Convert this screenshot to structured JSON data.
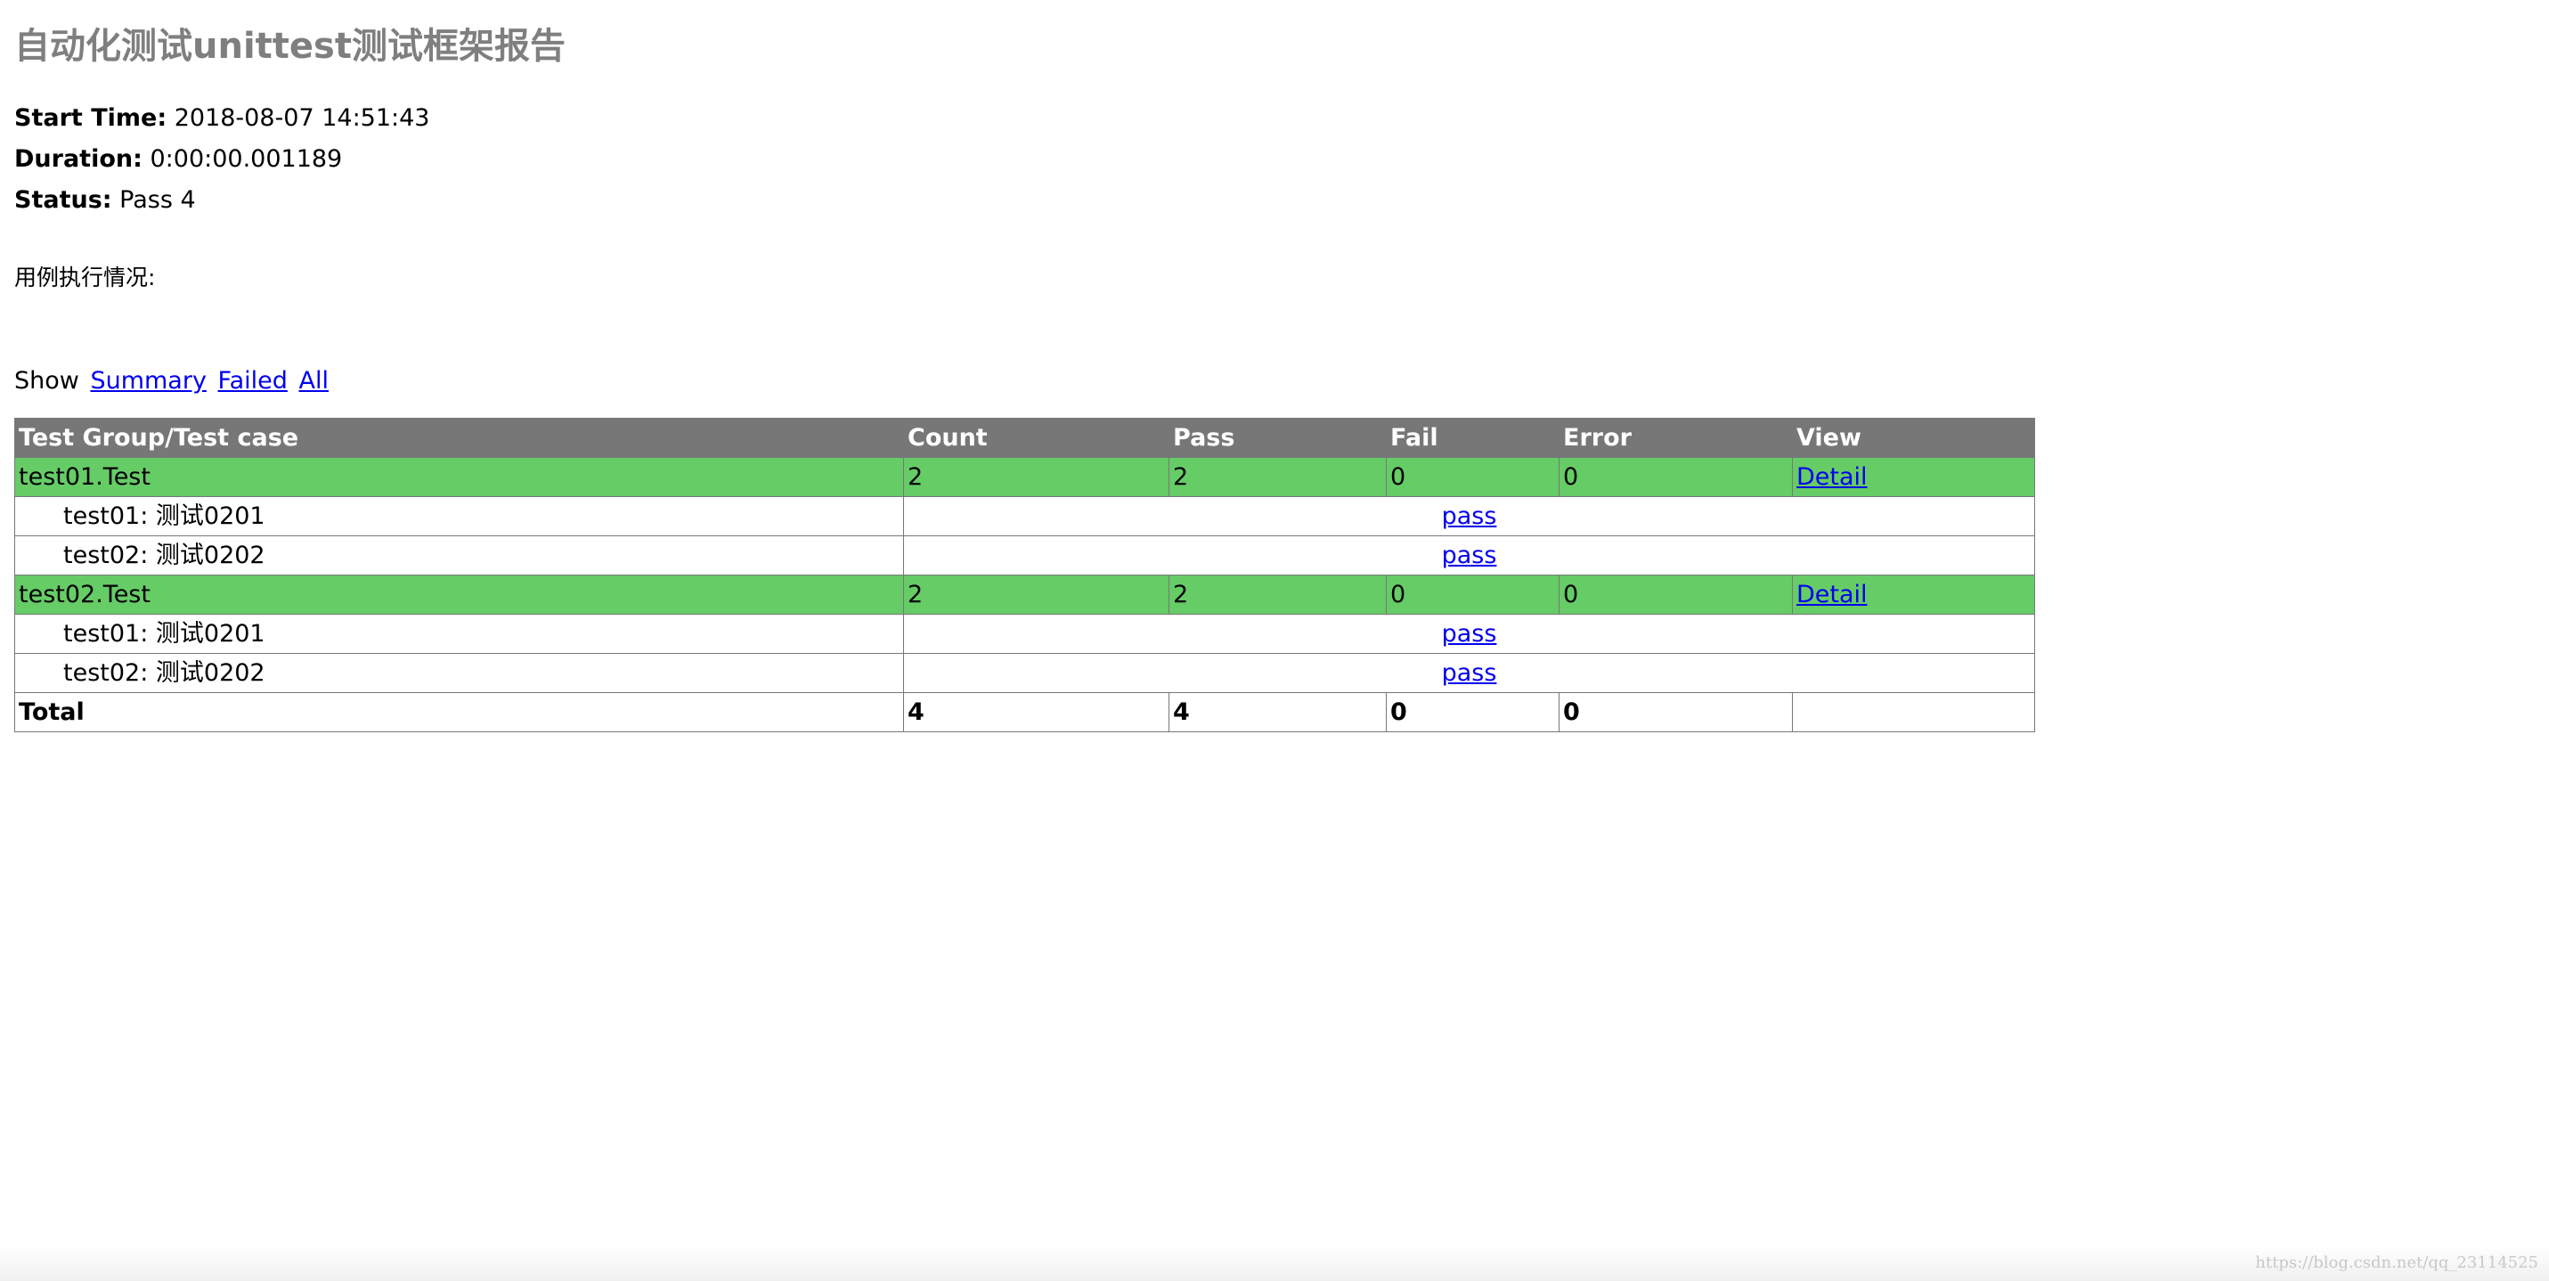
{
  "report": {
    "title": "自动化测试unittest测试框架报告"
  },
  "attributes": [
    {
      "name": "Start Time:",
      "value": "2018-08-07 14:51:43"
    },
    {
      "name": "Duration:",
      "value": "0:00:00.001189"
    },
    {
      "name": "Status:",
      "value": "Pass 4"
    }
  ],
  "description": "用例执行情况:",
  "show": {
    "label": "Show",
    "summary": "Summary",
    "failed": "Failed",
    "all": "All"
  },
  "table": {
    "headers": {
      "name": "Test Group/Test case",
      "count": "Count",
      "pass": "Pass",
      "fail": "Fail",
      "error": "Error",
      "view": "View"
    },
    "groups": [
      {
        "name": "test01.Test",
        "count": "2",
        "pass": "2",
        "fail": "0",
        "error": "0",
        "view": "Detail",
        "cases": [
          {
            "name": "test01: 测试0201",
            "status": "pass"
          },
          {
            "name": "test02: 测试0202",
            "status": "pass"
          }
        ]
      },
      {
        "name": "test02.Test",
        "count": "2",
        "pass": "2",
        "fail": "0",
        "error": "0",
        "view": "Detail",
        "cases": [
          {
            "name": "test01: 测试0201",
            "status": "pass"
          },
          {
            "name": "test02: 测试0202",
            "status": "pass"
          }
        ]
      }
    ],
    "total": {
      "label": "Total",
      "count": "4",
      "pass": "4",
      "fail": "0",
      "error": "0"
    }
  },
  "watermark": "https://blog.csdn.net/qq_23114525",
  "colors": {
    "title": "#7f7f7f",
    "header_bg": "#777777",
    "pass_group_bg": "#66cc66",
    "link": "#0000ee"
  }
}
